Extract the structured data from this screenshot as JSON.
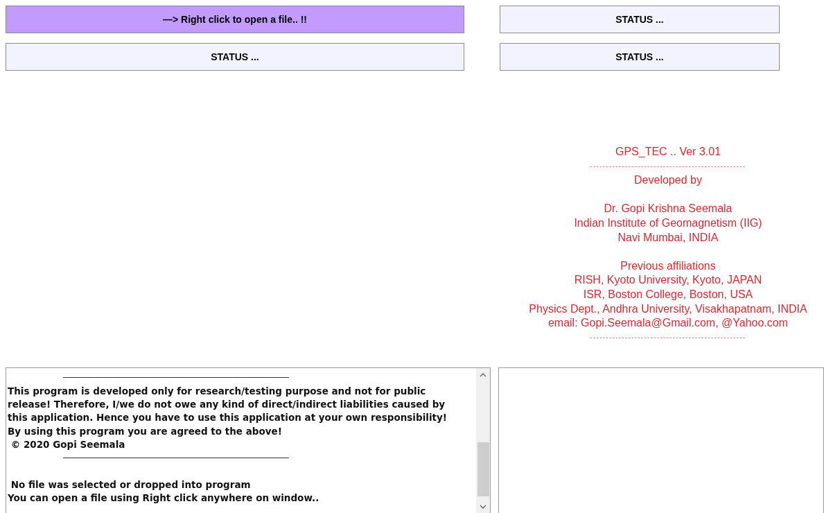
{
  "buttons": [
    {
      "label": "—> Right click to open a file.. !!",
      "highlighted": true
    },
    {
      "label": "STATUS ...",
      "highlighted": false
    },
    {
      "label": "STATUS ...",
      "highlighted": false
    },
    {
      "label": "STATUS ...",
      "highlighted": false
    }
  ],
  "credits": {
    "groups": [
      [
        "GPS_TEC .. Ver 3.01",
        "-------------------------------------------------",
        "Developed by"
      ],
      [
        "Dr. Gopi Krishna Seemala",
        "Indian Institute of Geomagnetism (IIG)",
        "Navi Mumbai, INDIA"
      ],
      [
        "Previous affiliations",
        "RISH, Kyoto University, Kyoto, JAPAN",
        "ISR, Boston College, Boston, USA",
        "Physics Dept., Andhra University, Visakhapatnam, INDIA",
        "email: Gopi.Seemala@Gmail.com, @Yahoo.com",
        "-------------------------------------------------"
      ]
    ]
  },
  "log": {
    "lines": [
      {
        "kind": "rule"
      },
      {
        "kind": "text",
        "text": "This program is developed only for research/testing purpose and not for public"
      },
      {
        "kind": "text",
        "text": "release! Therefore, I/we do not owe any kind of direct/indirect liabilities caused by"
      },
      {
        "kind": "text",
        "text": "this application. Hence you have to use this application at your own responsibility!"
      },
      {
        "kind": "text",
        "text": "By using this program you are agreed to the above!"
      },
      {
        "kind": "text",
        "text": " © 2020 Gopi Seemala"
      },
      {
        "kind": "rule"
      },
      {
        "kind": "blank"
      },
      {
        "kind": "text",
        "text": " No file was selected or dropped into program"
      },
      {
        "kind": "text",
        "text": "You can open a file using Right click anywhere on window.."
      }
    ]
  }
}
